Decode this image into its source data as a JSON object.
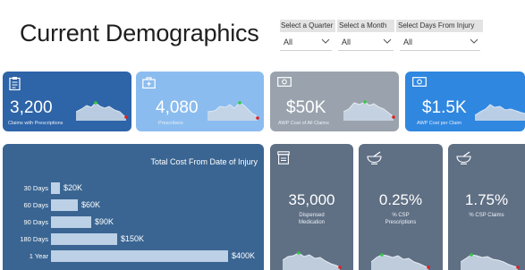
{
  "title": "Current Demographics",
  "filters": [
    {
      "label": "Select a Quarter",
      "value": "All"
    },
    {
      "label": "Select a Month",
      "value": "All"
    },
    {
      "label": "Select Days From Injury",
      "value": "All"
    }
  ],
  "kpis": [
    {
      "value": "3,200",
      "label": "Claims with Prescriptions",
      "icon": "clipboard-icon",
      "color": "#2e64a8"
    },
    {
      "value": "4,080",
      "label": "Prescribers",
      "icon": "medical-kit-icon",
      "color": "#8bbcef"
    },
    {
      "value": "$50K",
      "label": "AWP Cost of All Claims",
      "icon": "money-icon",
      "color": "#9aa3ad"
    },
    {
      "value": "$1.5K",
      "label": "AWP Cost per Claim",
      "icon": "money-icon",
      "color": "#2f87e0"
    }
  ],
  "cost_panel": {
    "title": "Total Cost From Date of Injury",
    "color": "#3a6592",
    "rows": [
      {
        "label": "30 Days",
        "value": "$20K",
        "amount": 20
      },
      {
        "label": "60 Days",
        "value": "$60K",
        "amount": 60
      },
      {
        "label": "90 Days",
        "value": "$90K",
        "amount": 90
      },
      {
        "label": "180 Days",
        "value": "$150K",
        "amount": 150
      },
      {
        "label": "1 Year",
        "value": "$400K",
        "amount": 400
      }
    ]
  },
  "bottom_cards": [
    {
      "value": "35,000",
      "label_line1": "Dispensed",
      "label_line2": "Medication",
      "icon": "pill-box-icon"
    },
    {
      "value": "0.25%",
      "label_line1": "% CSP",
      "label_line2": "Prescriptions",
      "icon": "mortar-pestle-icon"
    },
    {
      "value": "1.75%",
      "label_line1": "% CSP Claims",
      "label_line2": "",
      "icon": "mortar-pestle-icon"
    }
  ],
  "colors": {
    "slate": "#5f6f84",
    "spark_fill": "#c9d6e6",
    "spark_high": "#2ecc40",
    "spark_low": "#e02020"
  }
}
